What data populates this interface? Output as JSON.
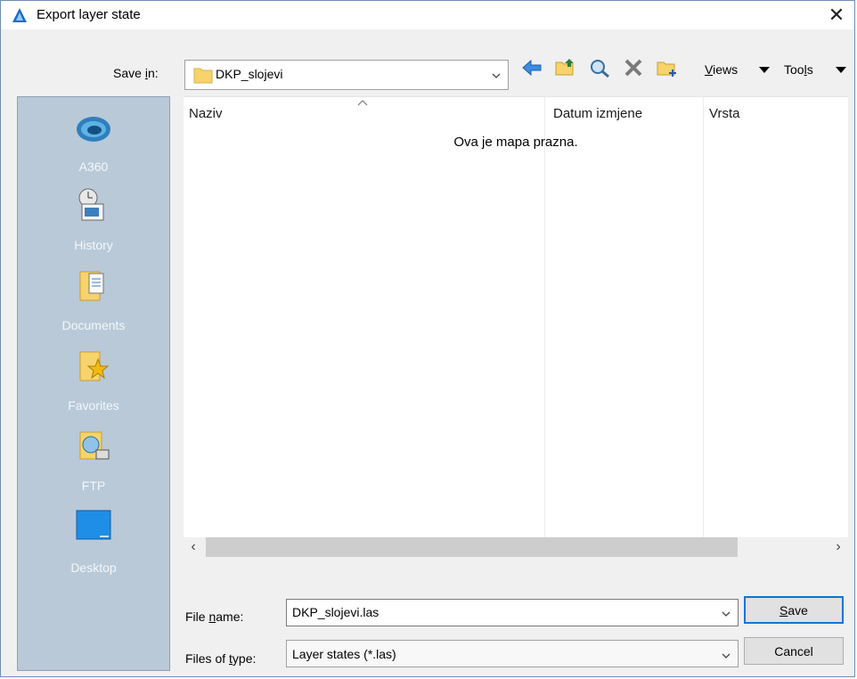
{
  "window": {
    "title": "Export layer state",
    "close_glyph": "✕"
  },
  "toolbar": {
    "save_in_label_pre": "Save ",
    "save_in_label_accel": "i",
    "save_in_label_post": "n:",
    "save_in_value": "DKP_slojevi",
    "icons": [
      "back-arrow-icon",
      "up-folder-icon",
      "search-web-icon",
      "delete-icon",
      "new-folder-icon"
    ],
    "views_accel": "V",
    "views_rest": "iews",
    "tools_pre": "Too",
    "tools_accel": "l",
    "tools_post": "s"
  },
  "places": [
    {
      "label": "A360",
      "icon": "a360-icon"
    },
    {
      "label": "History",
      "icon": "history-icon"
    },
    {
      "label": "Documents",
      "icon": "documents-icon"
    },
    {
      "label": "Favorites",
      "icon": "favorites-icon"
    },
    {
      "label": "FTP",
      "icon": "ftp-icon"
    },
    {
      "label": "Desktop",
      "icon": "desktop-icon"
    }
  ],
  "file_list": {
    "columns": [
      "Naziv",
      "Datum izmjene",
      "Vrsta"
    ],
    "empty_message": "Ova je mapa prazna.",
    "scroll_left": "‹",
    "scroll_right": "›"
  },
  "form": {
    "file_name_pre": "File ",
    "file_name_accel": "n",
    "file_name_post": "ame:",
    "file_name_value": "DKP_slojevi.las",
    "file_type_pre": "Files of ",
    "file_type_accel": "t",
    "file_type_post": "ype:",
    "file_type_value": "Layer states (*.las)",
    "save_accel": "S",
    "save_rest": "ave",
    "cancel_label": "Cancel"
  },
  "colors": {
    "places_bg": "#b9c9d8",
    "folder_yellow": "#f6d36b",
    "accent_blue": "#0078d7"
  }
}
